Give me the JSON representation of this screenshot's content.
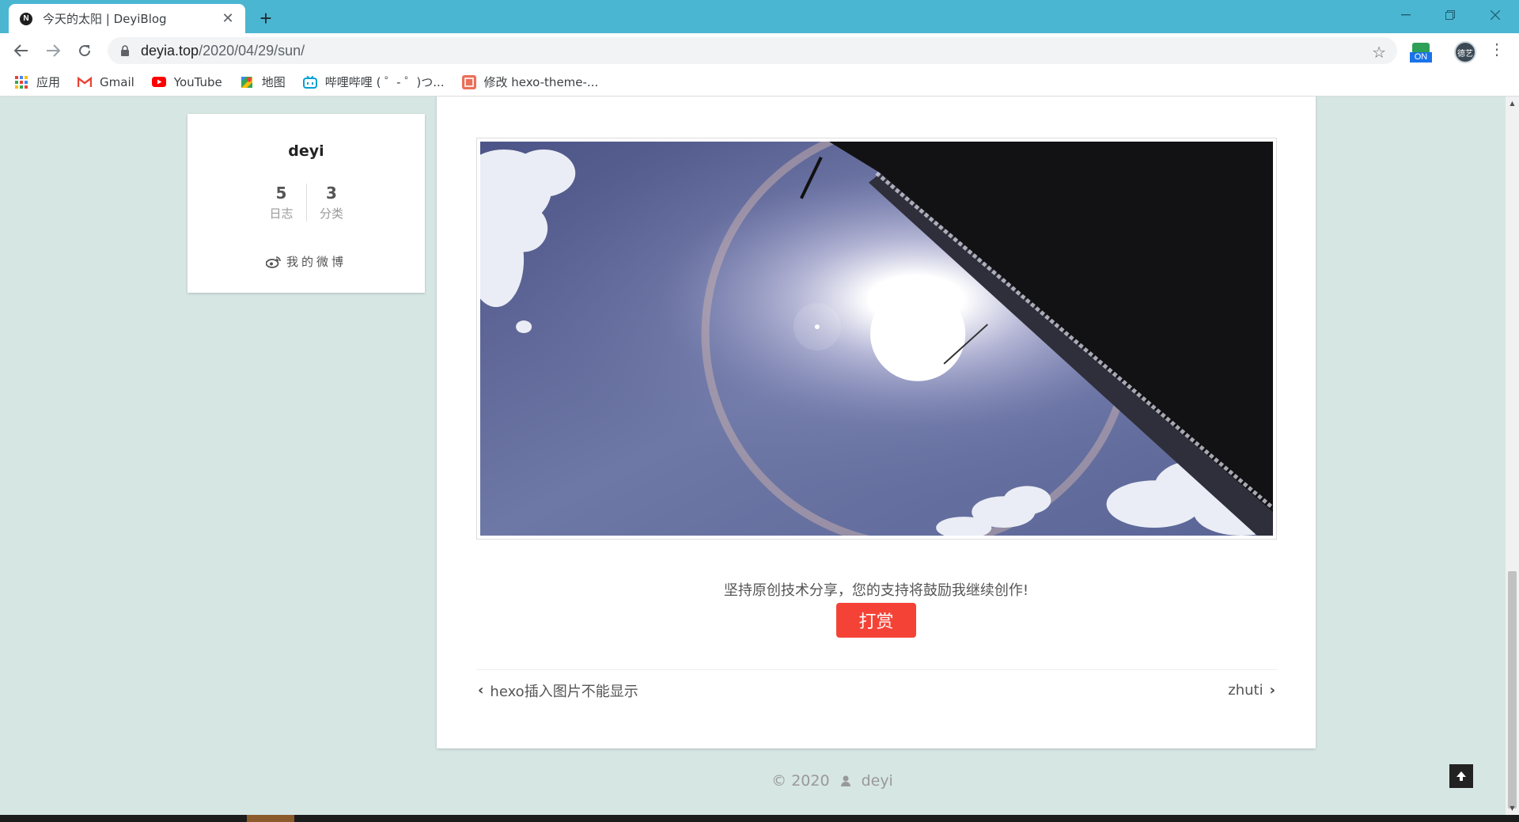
{
  "browser": {
    "tab_title": "今天的太阳 | DeyiBlog",
    "tab_favicon_letter": "N",
    "tab_close": "✕",
    "new_tab": "+",
    "url_host": "deyia.top",
    "url_path": "/2020/04/29/sun/",
    "extension_badge": "ON",
    "profile_initials": "德艺",
    "bookmarks": [
      {
        "label": "应用",
        "icon": "apps-grid-icon"
      },
      {
        "label": "Gmail",
        "icon": "gmail-icon"
      },
      {
        "label": "YouTube",
        "icon": "youtube-icon"
      },
      {
        "label": "地图",
        "icon": "maps-icon"
      },
      {
        "label": "哔哩哔哩 ( ゜- ゜)つ...",
        "icon": "bilibili-icon"
      },
      {
        "label": "修改 hexo-theme-...",
        "icon": "jianshu-icon"
      }
    ]
  },
  "sidebar": {
    "author": "deyi",
    "stats": [
      {
        "value": "5",
        "label": "日志"
      },
      {
        "value": "3",
        "label": "分类"
      }
    ],
    "weibo_label": "我的微博"
  },
  "post": {
    "image_description_icon": "sun-halo-photo",
    "reward_text": "坚持原创技术分享，您的支持将鼓励我继续创作!",
    "reward_button": "打赏",
    "prev_post": "hexo插入图片不能显示",
    "next_post": "zhuti"
  },
  "footer": {
    "copyright": "© 2020",
    "author": "deyi"
  },
  "colors": {
    "titlebar": "#4bb6d2",
    "page_background": "#d6e6e3",
    "reward_button": "#f44336"
  }
}
